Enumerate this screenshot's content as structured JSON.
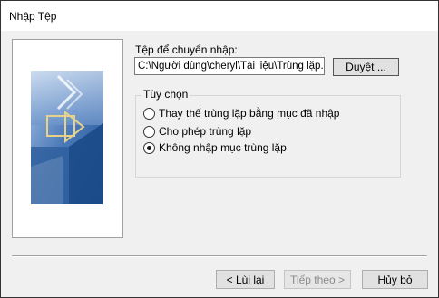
{
  "window": {
    "title": "Nhập Tệp"
  },
  "file": {
    "label": "Tệp để chuyển nhập:",
    "path": "C:\\Người dùng\\cheryl\\Tài liệu\\Trùng lặp.CSV",
    "browse_label": "Duyệt ..."
  },
  "options": {
    "legend": "Tùy chọn",
    "items": [
      {
        "label": "Thay thế trùng lặp bằng mục đã nhập",
        "checked": false
      },
      {
        "label": "Cho phép trùng lặp",
        "checked": false
      },
      {
        "label": "Không nhập mục trùng lặp",
        "checked": true
      }
    ]
  },
  "footer": {
    "back_label": "< Lùi lại",
    "next_label": "Tiếp theo >",
    "close_label": "Hủy bỏ"
  },
  "colors": {
    "dialog_bg": "#f0f0f0",
    "graphic_blue": "#2f5f9e",
    "graphic_accent": "#e6d28a"
  }
}
